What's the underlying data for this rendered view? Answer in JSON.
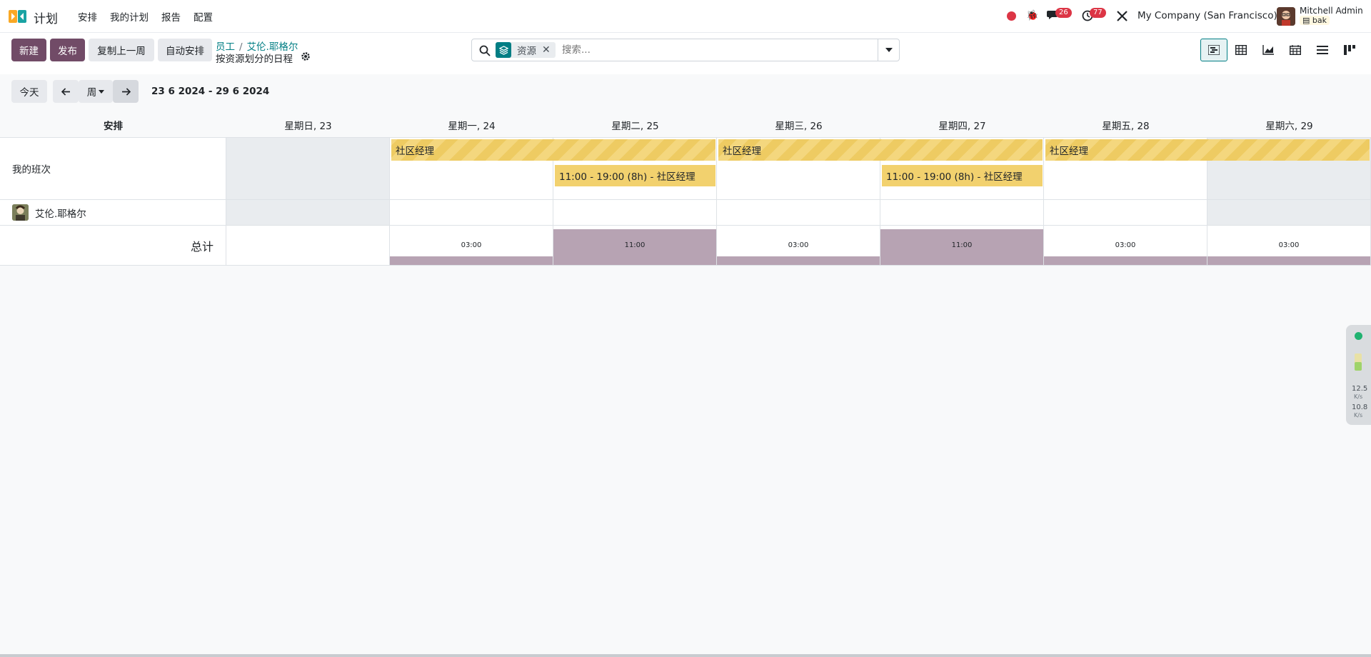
{
  "app": {
    "name": "计划"
  },
  "menu": [
    "安排",
    "我的计划",
    "报告",
    "配置"
  ],
  "systray": {
    "messages_count": "26",
    "activities_count": "77",
    "company": "My Company (San Francisco)",
    "user": "Mitchell Admin",
    "db": "bak"
  },
  "toolbar": {
    "new_label": "新建",
    "publish_label": "发布",
    "copy_label": "复制上一周",
    "auto_label": "自动安排"
  },
  "breadcrumb": {
    "parent": "员工",
    "record": "艾伦.耶格尔",
    "sep": "/"
  },
  "view_title": "按资源划分的日程",
  "search": {
    "facet": "资源",
    "placeholder": "搜索..."
  },
  "views": [
    "gantt-icon",
    "pivot-icon",
    "graph-icon",
    "calendar-icon",
    "list-icon",
    "kanban-icon"
  ],
  "datenav": {
    "today": "今天",
    "scale": "周",
    "range": "23 6 2024 - 29 6 2024"
  },
  "gantt": {
    "header_first": "安排",
    "days": [
      "星期日, 23",
      "星期一, 24",
      "星期二, 25",
      "星期三, 26",
      "星期四, 27",
      "星期五, 28",
      "星期六, 29"
    ],
    "rows": {
      "my_shifts": "我的班次",
      "employee": "艾伦.耶格尔"
    },
    "pills": {
      "role1": "社区经理",
      "role2": "社区经理",
      "role3": "社区经理",
      "shift1": "11:00 - 19:00 (8h) - 社区经理",
      "shift2": "11:00 - 19:00 (8h) - 社区经理"
    },
    "total_label": "总计",
    "totals": [
      "",
      "03:00",
      "11:00",
      "03:00",
      "11:00",
      "03:00",
      "03:00"
    ],
    "total_hours": [
      0,
      3,
      11,
      3,
      11,
      3,
      3
    ]
  },
  "widget": {
    "up": "12.5",
    "down": "10.8",
    "unit": "K/s"
  },
  "colors": {
    "primary": "#714b67",
    "link": "#017e84",
    "pill": "#f2d16e",
    "total_bar": "#b7a3b3"
  }
}
